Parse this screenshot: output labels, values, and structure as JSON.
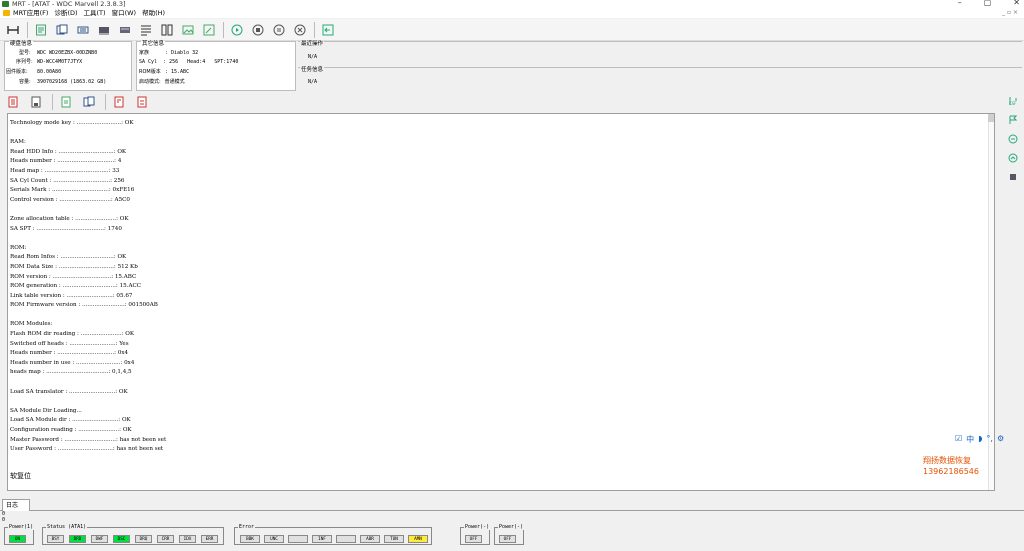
{
  "window": {
    "title": "MRT - [ATAT - WDC Marvell 2.3.8.3]",
    "controls": [
      "–",
      "▢",
      "✕"
    ]
  },
  "menu": {
    "items": [
      "MRT应用(F)",
      "诊断(D)",
      "工具(T)",
      "窗口(W)",
      "帮助(H)"
    ],
    "mdi_controls": "_ ▫ ×"
  },
  "toolbar": {
    "icons": [
      "connect-icon",
      "drive-info-icon",
      "copy-icon",
      "copy-alt-icon",
      "memory-icon",
      "hdd-icon",
      "list-icon",
      "module-icon",
      "image-icon",
      "edit-icon",
      "play-icon",
      "stop-icon",
      "pause-icon",
      "cancel-icon",
      "exit-icon"
    ]
  },
  "disk_info": {
    "title": "硬盘信息",
    "model_label": "型号:",
    "model": "WDC WD20EZBX-00DZNB0",
    "serial_label": "序列号:",
    "serial": "WD-WCC4M0T7JTYX",
    "firmware_label": "固件版本:",
    "firmware": "80.00A80",
    "capacity_label": "容量:",
    "capacity": "3907029168 (1863.02 GB)"
  },
  "other_info": {
    "title": "其它信息",
    "family_label": "家族",
    "family": ": Diablo 32",
    "sacyl_line": "SA Cyl  : 256   Head:4   SPT:1740",
    "rom_label": "ROM版本",
    "rom": ": 15.ABC",
    "boot_label": "启动模式:",
    "boot": " 普通模式"
  },
  "recent": {
    "title": "最近操作",
    "value": "N/A"
  },
  "task": {
    "title": "任务信息",
    "value": "N/A"
  },
  "log": {
    "lines": [
      "Technology mode key : .........................: OK",
      "",
      "RAM:",
      "Read HDD Info : ...............................: OK",
      "Heads number : ................................: 4",
      "Head map : ....................................: 33",
      "SA Cyl Count : ................................: 256",
      "Serials Mark : ................................: 0xFE16",
      "Control version : .............................: A5C0",
      "",
      "Zone allocation table : .......................: OK",
      "SA SPT : ......................................: 1740",
      "",
      "ROM:",
      "Read Rom Infos : ..............................: OK",
      "ROM Data Size : ...............................: 512 Kb",
      "ROM version : .................................: 15.ABC",
      "ROM generation : ..............................: 15.ACC",
      "Link table version : ..........................: 05.67",
      "ROM Firmware version : ........................: 001500AB",
      "",
      "ROM Modules:",
      "Flash ROM dir reading : .......................: OK",
      "Switched off heads : ..........................: Yes",
      "Heads number : ................................: 0x4",
      "Heads number in use : .........................: 0x4",
      "heads map : ...................................: 0,1,4,5",
      "",
      "Load SA translator : ..........................: OK",
      "",
      "SA Module Dir Loading...",
      "Load SA Module dir : ..........................: OK",
      "Configuration reading : .......................: OK",
      "Master Password : .............................: has not been set",
      "User Password : ...............................: has not been set"
    ],
    "soft_reset": "软复位"
  },
  "watermark": {
    "line1": "翔扬数据恢复",
    "line2": "13962186546"
  },
  "ime": {
    "items": [
      "☑",
      "中",
      "◗",
      "°,",
      "⚙"
    ]
  },
  "tab": {
    "label": "日志"
  },
  "mini_fields": [
    "0",
    "0"
  ],
  "status": {
    "power1": {
      "title": "Power(1)",
      "buttons": [
        {
          "label": "ON",
          "state": "on"
        }
      ]
    },
    "status_ata": {
      "title": "Status (ATA1)",
      "buttons": [
        {
          "label": "BSY",
          "state": "off"
        },
        {
          "label": "DRD",
          "state": "on"
        },
        {
          "label": "DWF",
          "state": "off"
        },
        {
          "label": "DSC",
          "state": "on"
        },
        {
          "label": "DRQ",
          "state": "off"
        },
        {
          "label": "CRR",
          "state": "off"
        },
        {
          "label": "IDX",
          "state": "off"
        },
        {
          "label": "ERR",
          "state": "off"
        }
      ]
    },
    "error": {
      "title": "Error",
      "buttons": [
        {
          "label": "BBK",
          "state": "off"
        },
        {
          "label": "UNC",
          "state": "off"
        },
        {
          "label": "",
          "state": "off"
        },
        {
          "label": "INF",
          "state": "off"
        },
        {
          "label": "",
          "state": "off"
        },
        {
          "label": "ABR",
          "state": "off"
        },
        {
          "label": "TON",
          "state": "off"
        },
        {
          "label": "AMN",
          "state": "yel"
        }
      ]
    },
    "power_a": {
      "title": "Power(-)",
      "buttons": [
        {
          "label": "OFF",
          "state": "off"
        }
      ]
    },
    "power_b": {
      "title": "Power(-)",
      "buttons": [
        {
          "label": "OFF",
          "state": "off"
        }
      ]
    }
  },
  "colors": {
    "on": "#00e040",
    "warn": "#ffeb3b",
    "watermark": "#e65100",
    "ime": "#1565c0"
  }
}
